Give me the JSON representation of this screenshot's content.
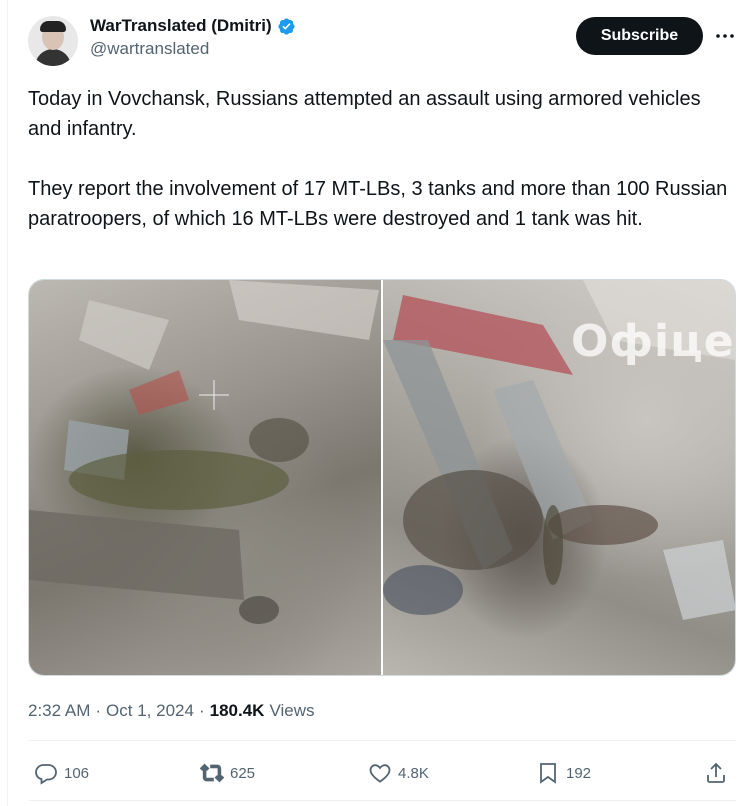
{
  "author": {
    "display_name": "WarTranslated (Dmitri)",
    "handle": "@wartranslated"
  },
  "header": {
    "subscribe_label": "Subscribe"
  },
  "tweet": {
    "paragraph_1": "Today in Vovchansk, Russians attempted an assault using armored vehicles and infantry.",
    "paragraph_2": "They report the involvement of 17 MT-LBs, 3 tanks and more than 100 Russian paratroopers, of which 16 MT-LBs were destroyed and 1 tank was hit."
  },
  "media": {
    "watermark_text": "Офіце"
  },
  "meta": {
    "time": "2:32 AM",
    "separator": "·",
    "date": "Oct 1, 2024",
    "views_count": "180.4K",
    "views_label": "Views"
  },
  "actions": {
    "replies": "106",
    "reposts": "625",
    "likes": "4.8K",
    "bookmarks": "192"
  },
  "colors": {
    "verified": "#1d9bf0",
    "subscribe_bg": "#0f1419",
    "muted_text": "#536471"
  }
}
